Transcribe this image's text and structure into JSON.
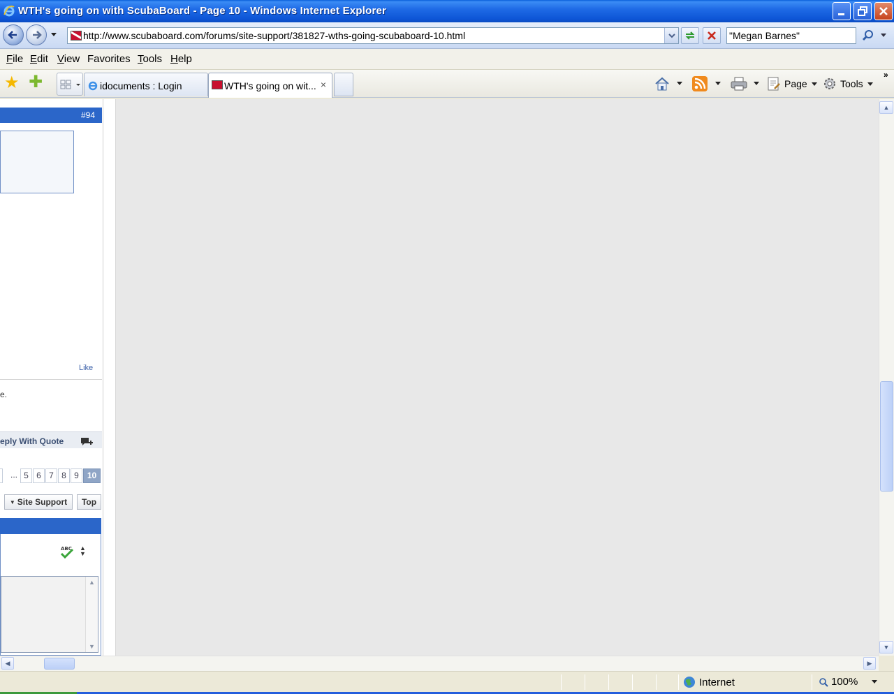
{
  "window": {
    "title": "WTH's going on with ScubaBoard - Page 10 - Windows Internet Explorer"
  },
  "address_bar": {
    "url": "http://www.scubaboard.com/forums/site-support/381827-wths-going-scubaboard-10.html"
  },
  "search": {
    "value": "\"Megan Barnes\""
  },
  "menu": {
    "items": [
      {
        "label": "File",
        "accel": "F",
        "rest": "ile"
      },
      {
        "label": "Edit",
        "accel": "E",
        "rest": "dit"
      },
      {
        "label": "View",
        "accel": "V",
        "rest": "iew"
      },
      {
        "label": "Favorites",
        "accel": "",
        "rest": "Favorites"
      },
      {
        "label": "Tools",
        "accel": "T",
        "rest": "ools"
      },
      {
        "label": "Help",
        "accel": "H",
        "rest": "elp"
      }
    ]
  },
  "tabs": [
    {
      "label": "idocuments : Login",
      "active": false
    },
    {
      "label": "WTH's going on wit...",
      "active": true,
      "close": "×"
    }
  ],
  "command_bar": {
    "page_label": "Page",
    "tools_label": "Tools"
  },
  "forum": {
    "post_number": "#94",
    "like_label": "Like",
    "text_fragment": "e.",
    "reply_with_quote_label": "eply With Quote",
    "pagination": {
      "ellipsis": "...",
      "pages": [
        "5",
        "6",
        "7",
        "8",
        "9"
      ],
      "current": "10"
    },
    "site_support_label": "Site Support",
    "top_label": "Top"
  },
  "status_bar": {
    "zone": "Internet",
    "zoom": "100%"
  },
  "colors": {
    "forum_header_blue": "#2B66C9",
    "content_background": "#E8E8E8",
    "xp_title_blue": "#0D55D6"
  }
}
